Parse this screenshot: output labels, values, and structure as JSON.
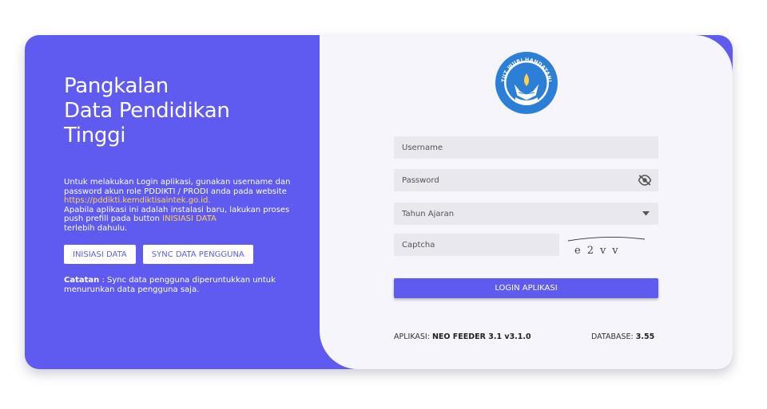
{
  "brand": {
    "title_lines": [
      "Pangkalan",
      "Data Pendidikan",
      "Tinggi"
    ],
    "accent_color": "#5f5bf0",
    "highlight_color": "#ffd24d",
    "logo_text": "TUT WURI HANDAYANI"
  },
  "info": {
    "line1": "Untuk melakukan Login aplikasi, gunakan username dan password akun role PDDIKTI / PRODI anda pada website",
    "website": "https://pddikti.kemdiktisaintek.go.id.",
    "line2": "Apabila aplikasi ini adalah instalasi baru, lakukan proses push prefill pada button",
    "button_ref": "INISIASI DATA",
    "line3": "terlebih dahulu."
  },
  "actions": {
    "init_label": "INISIASI DATA",
    "sync_label": "SYNC DATA PENGGUNA"
  },
  "note": {
    "label": "Catatan",
    "text": " : Sync data pengguna diperuntukkan untuk menurunkan data pengguna saja."
  },
  "form": {
    "username_placeholder": "Username",
    "password_placeholder": "Password",
    "year_placeholder": "Tahun Ajaran",
    "captcha_placeholder": "Captcha",
    "captcha_text": "e2vv",
    "login_label": "LOGIN APLIKASI",
    "password_icon": "eye-off-icon",
    "select_icon": "caret-down-icon"
  },
  "footer": {
    "app_label": "APLIKASI:",
    "app_value": "NEO FEEDER 3.1 v3.1.0",
    "db_label": "DATABASE:",
    "db_value": "3.55"
  }
}
